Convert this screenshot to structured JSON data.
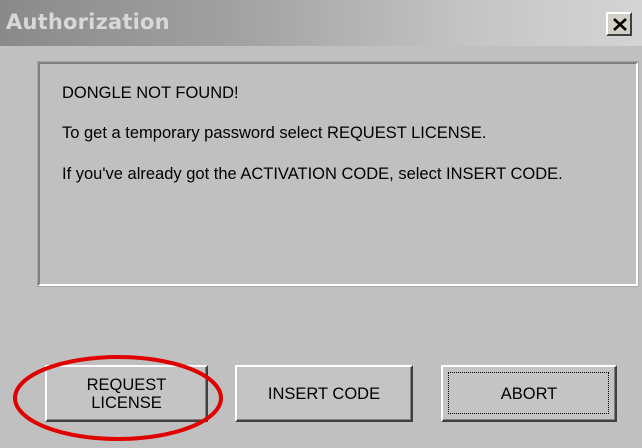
{
  "window": {
    "title": "Authorization",
    "close_glyph": "X"
  },
  "message": {
    "line1": "DONGLE NOT FOUND!",
    "line2": "To get a temporary password select REQUEST LICENSE.",
    "line3": "If you've already got the ACTIVATION CODE, select INSERT CODE."
  },
  "buttons": {
    "request_license": "REQUEST LICENSE",
    "insert_code": "INSERT CODE",
    "abort": "ABORT"
  },
  "icons": {
    "close": "close-icon"
  },
  "colors": {
    "annotation_circle": "#e00000",
    "window_background": "#c0c0c0"
  }
}
